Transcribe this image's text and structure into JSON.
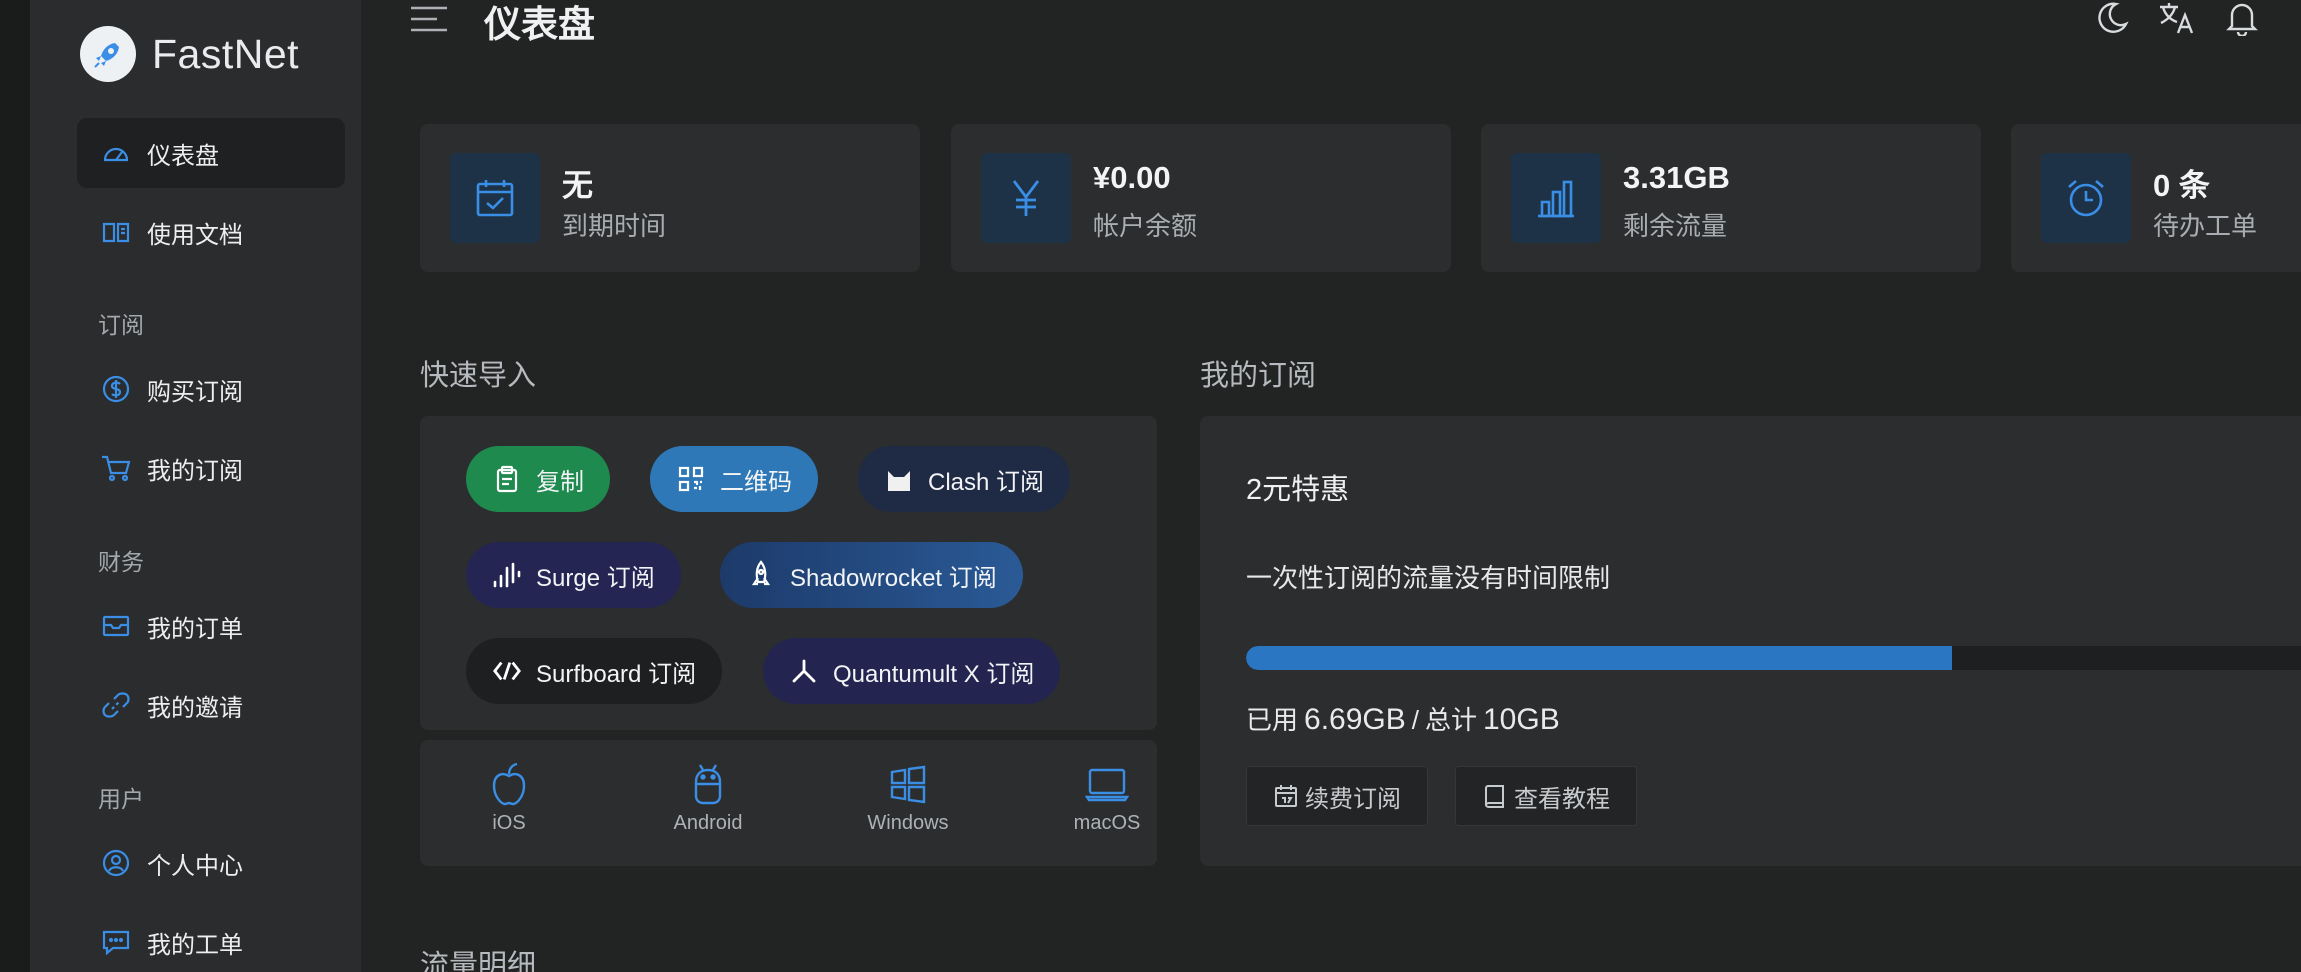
{
  "colors": {
    "accent": "#2a76c3",
    "sidebar_bg": "#2a2c2d",
    "page_bg": "#222323",
    "card_bg": "#2b2d2e",
    "icon_blue": "#3a8ee6"
  },
  "brand": {
    "name": "FastNet",
    "logo_icon": "rocket-icon"
  },
  "header": {
    "title": "仪表盘",
    "menu_icon": "hamburger-menu-icon",
    "icons": [
      "moon-icon",
      "translate-icon",
      "bell-icon"
    ]
  },
  "sidebar": {
    "items": [
      {
        "label": "仪表盘",
        "icon": "dashboard-gauge-icon",
        "active": true
      },
      {
        "label": "使用文档",
        "icon": "book-open-icon"
      }
    ],
    "sections": [
      {
        "title": "订阅",
        "items": [
          {
            "label": "购买订阅",
            "icon": "dollar-circle-icon"
          },
          {
            "label": "我的订阅",
            "icon": "cart-icon"
          }
        ]
      },
      {
        "title": "财务",
        "items": [
          {
            "label": "我的订单",
            "icon": "inbox-icon"
          },
          {
            "label": "我的邀请",
            "icon": "link-icon"
          }
        ]
      },
      {
        "title": "用户",
        "items": [
          {
            "label": "个人中心",
            "icon": "user-circle-icon"
          },
          {
            "label": "我的工单",
            "icon": "message-icon"
          }
        ]
      }
    ]
  },
  "stats": [
    {
      "value": "无",
      "label": "到期时间",
      "icon": "calendar-check-icon"
    },
    {
      "value": "¥0.00",
      "label": "帐户余额",
      "icon": "yen-icon"
    },
    {
      "value": "3.31GB",
      "label": "剩余流量",
      "icon": "bar-chart-icon"
    },
    {
      "value": "0 条",
      "label": "待办工单",
      "icon": "alarm-clock-icon"
    }
  ],
  "quick_import": {
    "title": "快速导入",
    "buttons": [
      {
        "label": "复制",
        "icon": "clipboard-icon"
      },
      {
        "label": "二维码",
        "icon": "qrcode-icon"
      },
      {
        "label": "Clash 订阅",
        "icon": "clash-cat-icon"
      },
      {
        "label": "Surge 订阅",
        "icon": "surge-icon"
      },
      {
        "label": "Shadowrocket 订阅",
        "icon": "shadowrocket-rocket-icon"
      },
      {
        "label": "Surfboard 订阅",
        "icon": "surfboard-icon"
      },
      {
        "label": "Quantumult X 订阅",
        "icon": "quantumult-icon"
      }
    ],
    "platforms": [
      {
        "label": "iOS",
        "icon": "apple-icon"
      },
      {
        "label": "Android",
        "icon": "android-icon"
      },
      {
        "label": "Windows",
        "icon": "windows-icon"
      },
      {
        "label": "macOS",
        "icon": "laptop-icon"
      }
    ]
  },
  "subscription": {
    "title": "我的订阅",
    "plan_name": "2元特惠",
    "description": "一次性订阅的流量没有时间限制",
    "used_fraction": 0.669,
    "used_prefix": "已用",
    "used_value": "6.69GB",
    "separator": "/",
    "total_prefix": "总计",
    "total_value": "10GB",
    "renew_label": "续费订阅",
    "renew_icon": "calendar-icon",
    "tutorial_label": "查看教程",
    "tutorial_icon": "book-icon"
  },
  "traffic_detail": {
    "title": "流量明细"
  }
}
